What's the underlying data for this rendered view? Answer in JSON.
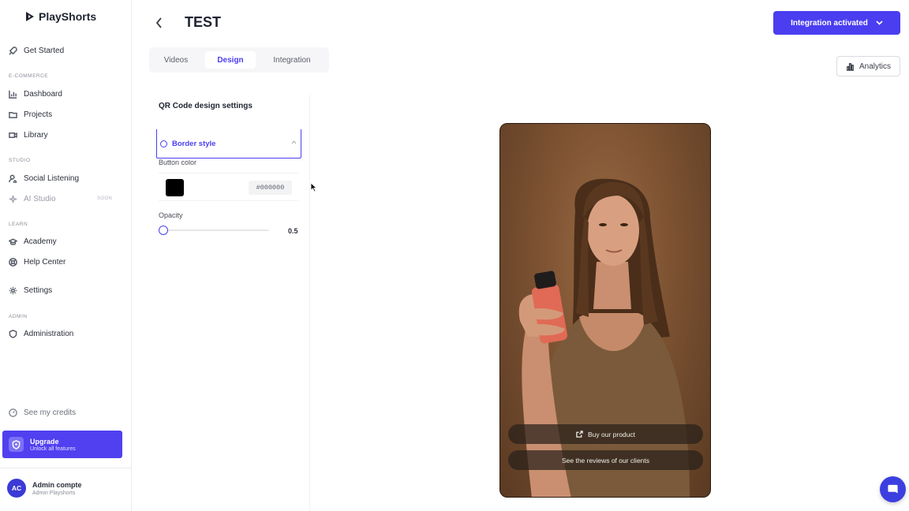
{
  "app": {
    "name": "PlayShorts"
  },
  "sidebar": {
    "get_started": "Get Started",
    "sections": {
      "ecommerce": "E-COMMERCE",
      "studio": "STUDIO",
      "learn": "LEARN",
      "admin": "ADMIN"
    },
    "items": {
      "dashboard": "Dashboard",
      "projects": "Projects",
      "library": "Library",
      "social_listening": "Social Listening",
      "ai_studio": "AI Studio",
      "ai_studio_badge": "SOON",
      "academy": "Academy",
      "help_center": "Help Center",
      "settings": "Settings",
      "administration": "Administration"
    },
    "credits": "See my credits",
    "upgrade": {
      "title": "Upgrade",
      "subtitle": "Unlock all features"
    },
    "account": {
      "initials": "AC",
      "name": "Admin compte",
      "org": "Admin Playshorts"
    }
  },
  "header": {
    "title": "TEST",
    "integration_button": "Integration activated",
    "analytics_button": "Analytics"
  },
  "tabs": [
    {
      "label": "Videos",
      "active": false
    },
    {
      "label": "Design",
      "active": true
    },
    {
      "label": "Integration",
      "active": false
    }
  ],
  "design_panel": {
    "title": "QR Code design settings",
    "accordion_label": "Border style",
    "button_color_label": "Button color",
    "button_color_hex": "#000000",
    "opacity_label": "Opacity",
    "opacity_value": "0.5"
  },
  "preview": {
    "cta_primary": "Buy our product",
    "cta_secondary": "See the reviews of our clients"
  },
  "colors": {
    "accent": "#4a3ef0",
    "upgrade_bg": "#5040f0",
    "chat_bg": "#3c3fe0"
  }
}
